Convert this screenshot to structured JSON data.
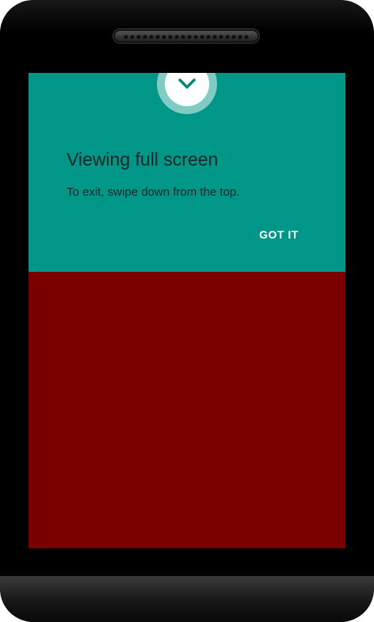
{
  "dialog": {
    "title": "Viewing full screen",
    "message": "To exit, swipe down from the top.",
    "got_it_label": "GOT IT",
    "icon": "chevron-down-icon"
  },
  "colors": {
    "dialog_background": "#009688",
    "icon_ring": "#80cbc4",
    "icon_chevron": "#00897b",
    "app_background": "#7a0000",
    "device_body": "#000000"
  }
}
